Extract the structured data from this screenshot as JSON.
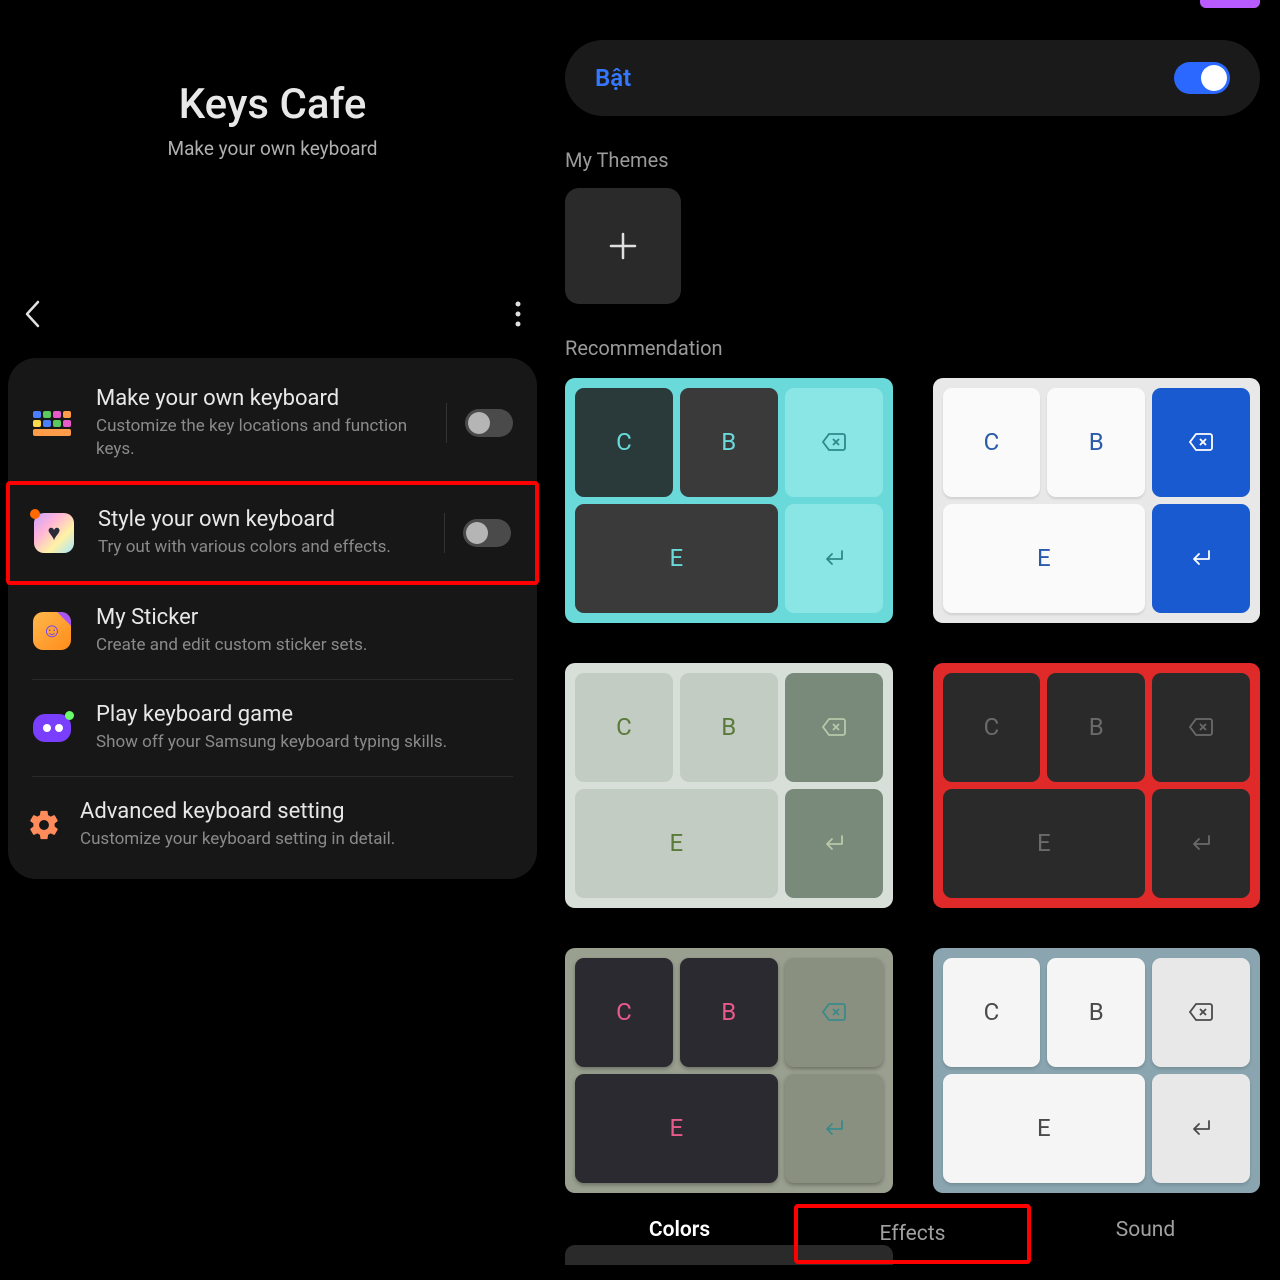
{
  "header": {
    "title": "Keys Cafe",
    "subtitle": "Make your own keyboard"
  },
  "settings": [
    {
      "title": "Make your own keyboard",
      "desc": "Customize the key locations and function keys."
    },
    {
      "title": "Style your own keyboard",
      "desc": "Try out with various colors and effects."
    },
    {
      "title": "My Sticker",
      "desc": "Create and edit custom sticker sets."
    },
    {
      "title": "Play keyboard game",
      "desc": "Show off your Samsung keyboard typing skills."
    },
    {
      "title": "Advanced keyboard setting",
      "desc": "Customize your keyboard setting in detail."
    }
  ],
  "right": {
    "enable_label": "Bật",
    "my_themes_label": "My Themes",
    "recommendation_label": "Recommendation"
  },
  "preview_keys": {
    "c": "C",
    "b": "B",
    "e": "E"
  },
  "tabs": {
    "colors": "Colors",
    "effects": "Effects",
    "sound": "Sound"
  }
}
